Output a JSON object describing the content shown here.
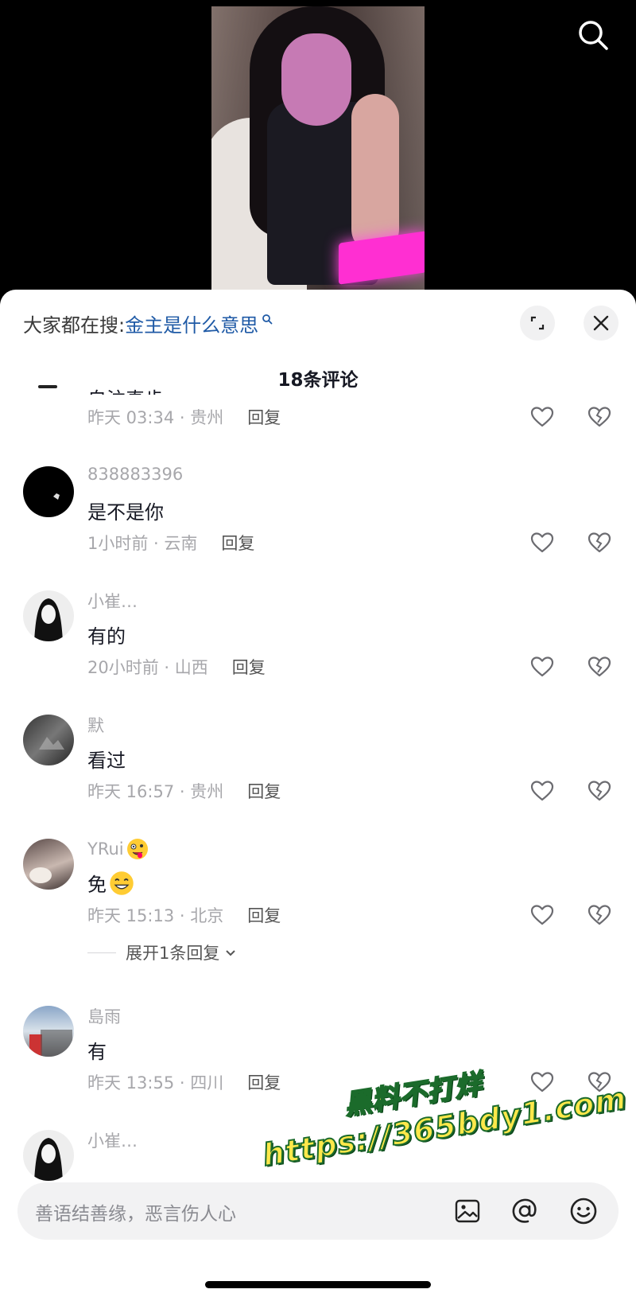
{
  "search_suggest": {
    "prefix": "大家都在搜:",
    "query": "金主是什么意思"
  },
  "comment_count": "18条评论",
  "partial_comment": {
    "text": "自注真步",
    "time": "昨天 03:34 · 贵州",
    "reply": "回复"
  },
  "comments": [
    {
      "user": "838883396",
      "text": "是不是你",
      "time": "1小时前 · 云南",
      "reply": "回复"
    },
    {
      "user": "小崔…",
      "text": "有的",
      "time": "20小时前 · 山西",
      "reply": "回复"
    },
    {
      "user": "默",
      "text": "看过",
      "time": "昨天 16:57 · 贵州",
      "reply": "回复"
    },
    {
      "user": "YRui",
      "text": "免",
      "time": "昨天 15:13 · 北京",
      "reply": "回复"
    },
    {
      "user": "島雨",
      "text": "有",
      "time": "昨天 13:55 · 四川",
      "reply": "回复"
    },
    {
      "user": "小崔…"
    }
  ],
  "expand_replies": "展开1条回复",
  "input": {
    "placeholder": "善语结善缘，恶言伤人心"
  },
  "watermark": {
    "line1": "黑料不打烊",
    "line2": "https://365bdy1.com"
  },
  "colors": {
    "link": "#1f5aa6",
    "meta": "#a7a7ab",
    "text": "#161823"
  }
}
